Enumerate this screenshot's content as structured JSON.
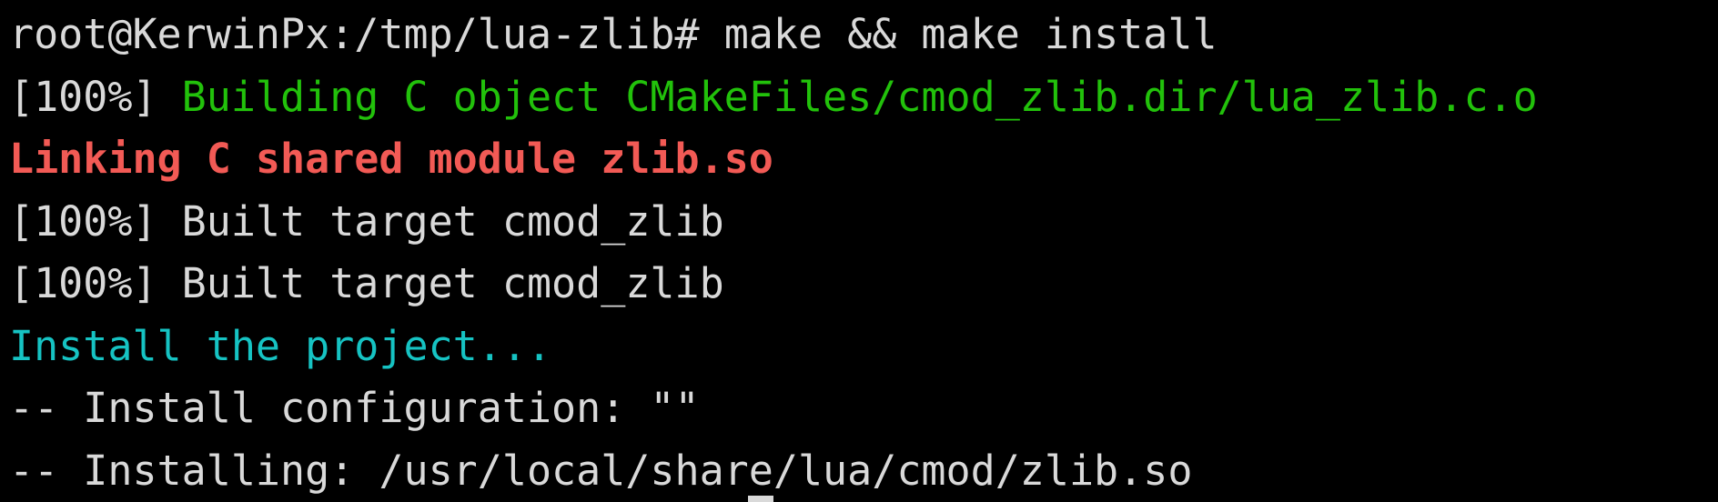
{
  "terminal": {
    "prompt": "root@KerwinPx:/tmp/lua-zlib# ",
    "command": "make && make install",
    "lines": [
      {
        "prefix": "[100%] ",
        "text": "Building C object CMakeFiles/cmod_zlib.dir/lua_zlib.c.o",
        "color": "#22c10b"
      },
      {
        "prefix": "",
        "text": "Linking C shared module zlib.so",
        "color": "#f25a55"
      },
      {
        "prefix": "[100%] ",
        "text": "Built target cmod_zlib",
        "color": "#d9d9d9"
      },
      {
        "prefix": "[100%] ",
        "text": "Built target cmod_zlib",
        "color": "#d9d9d9"
      },
      {
        "prefix": "",
        "text": "Install the project...",
        "color": "#16c3c3"
      },
      {
        "prefix": "",
        "text": "-- Install configuration: \"\"",
        "color": "#d9d9d9"
      },
      {
        "prefix": "",
        "text": "-- Installing: /usr/local/share/lua/cmod/zlib.so",
        "color": "#d9d9d9"
      }
    ]
  },
  "colors": {
    "background": "#000000",
    "foreground": "#d9d9d9",
    "green": "#22c10b",
    "red": "#f25a55",
    "cyan": "#16c3c3"
  }
}
